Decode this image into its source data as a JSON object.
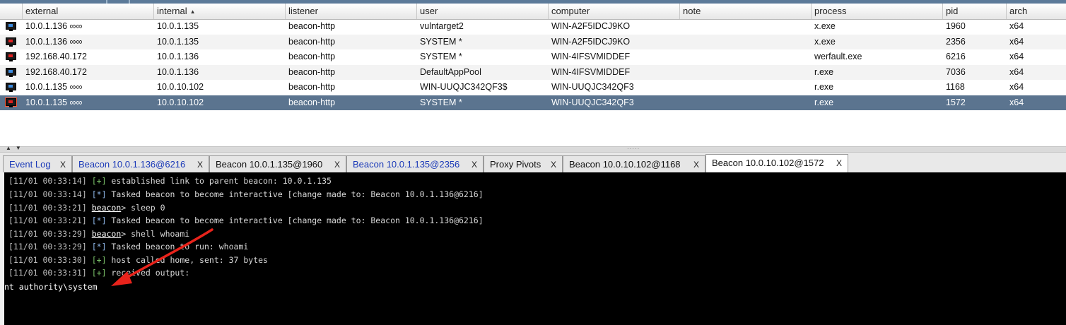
{
  "table": {
    "columns": [
      "external",
      "internal",
      "listener",
      "user",
      "computer",
      "note",
      "process",
      "pid",
      "arch"
    ],
    "sorted_column": "internal",
    "rows": [
      {
        "external": "10.0.1.136 ∞∞",
        "internal": "10.0.1.135",
        "listener": "beacon-http",
        "user": "vulntarget2",
        "computer": "WIN-A2F5IDCJ9KO",
        "note": "",
        "process": "x.exe",
        "pid": "1960",
        "arch": "x64",
        "icon": "monitor-icon"
      },
      {
        "external": "10.0.1.136 ∞∞",
        "internal": "10.0.1.135",
        "listener": "beacon-http",
        "user": "SYSTEM *",
        "computer": "WIN-A2F5IDCJ9KO",
        "note": "",
        "process": "x.exe",
        "pid": "2356",
        "arch": "x64",
        "icon": "admin-monitor-icon"
      },
      {
        "external": "192.168.40.172",
        "internal": "10.0.1.136",
        "listener": "beacon-http",
        "user": "SYSTEM *",
        "computer": "WIN-4IFSVMIDDEF",
        "note": "",
        "process": "werfault.exe",
        "pid": "6216",
        "arch": "x64",
        "icon": "admin-monitor-icon"
      },
      {
        "external": "192.168.40.172",
        "internal": "10.0.1.136",
        "listener": "beacon-http",
        "user": "DefaultAppPool",
        "computer": "WIN-4IFSVMIDDEF",
        "note": "",
        "process": "r.exe",
        "pid": "7036",
        "arch": "x64",
        "icon": "monitor-icon"
      },
      {
        "external": "10.0.1.135 ∞∞",
        "internal": "10.0.10.102",
        "listener": "beacon-http",
        "user": "WIN-UUQJC342QF3$",
        "computer": "WIN-UUQJC342QF3",
        "note": "",
        "process": "r.exe",
        "pid": "1168",
        "arch": "x64",
        "icon": "monitor-icon"
      },
      {
        "external": "10.0.1.135 ∞∞",
        "internal": "10.0.10.102",
        "listener": "beacon-http",
        "user": "SYSTEM *",
        "computer": "WIN-UUQJC342QF3",
        "note": "",
        "process": "r.exe",
        "pid": "1572",
        "arch": "x64",
        "icon": "admin-monitor-icon"
      }
    ]
  },
  "tabs": [
    {
      "label": "Event Log",
      "close": "X"
    },
    {
      "label": "Beacon 10.0.1.136@6216",
      "close": "X"
    },
    {
      "label": "Beacon 10.0.1.135@1960",
      "close": "X"
    },
    {
      "label": "Beacon 10.0.1.135@2356",
      "close": "X"
    },
    {
      "label": "Proxy Pivots",
      "close": "X"
    },
    {
      "label": "Beacon 10.0.10.102@1168",
      "close": "X"
    },
    {
      "label": "Beacon 10.0.10.102@1572",
      "close": "X"
    }
  ],
  "console": {
    "lines": [
      {
        "ts": "[11/01 00:33:14]",
        "tag": "[+]",
        "text": " established link to parent beacon: 10.0.1.135"
      },
      {
        "ts": "[11/01 00:33:14]",
        "tag": "[*]",
        "text": " Tasked beacon to become interactive [change made to: Beacon 10.0.1.136@6216]"
      },
      {
        "ts": "[11/01 00:33:21]",
        "prompt": "beacon",
        "text": "> sleep 0"
      },
      {
        "ts": "[11/01 00:33:21]",
        "tag": "[*]",
        "text": " Tasked beacon to become interactive [change made to: Beacon 10.0.1.136@6216]"
      },
      {
        "ts": "[11/01 00:33:29]",
        "prompt": "beacon",
        "text": "> shell whoami"
      },
      {
        "ts": "[11/01 00:33:29]",
        "tag": "[*]",
        "text": " Tasked beacon to run: whoami"
      },
      {
        "ts": "[11/01 00:33:30]",
        "tag": "[+]",
        "text": " host called home, sent: 37 bytes"
      },
      {
        "ts": "[11/01 00:33:31]",
        "tag": "[+]",
        "text": " received output:"
      }
    ],
    "output": "nt authority\\system"
  },
  "colors": {
    "selection": "#5b748f",
    "console_bg": "#000000",
    "tab_link": "#1a39b8",
    "annotation_arrow": "#e8231b"
  }
}
